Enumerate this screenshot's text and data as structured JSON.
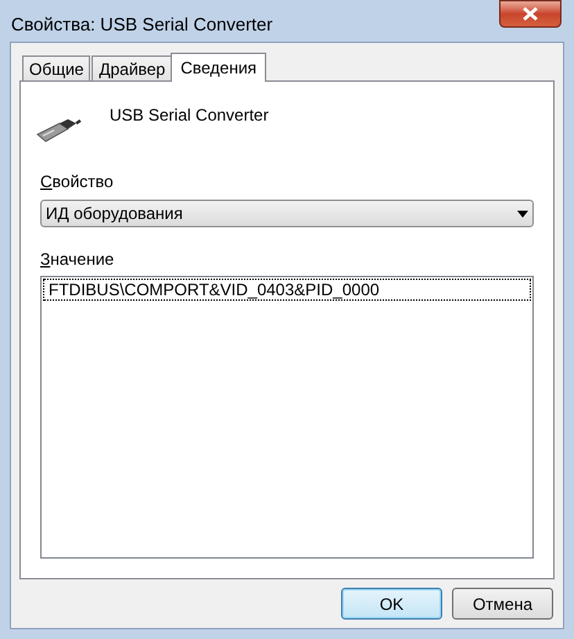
{
  "window": {
    "title": "Свойства: USB Serial Converter"
  },
  "tabs": [
    {
      "label": "Общие",
      "selected": false
    },
    {
      "label": "Драйвер",
      "selected": false
    },
    {
      "label": "Сведения",
      "selected": true
    }
  ],
  "device": {
    "name": "USB Serial Converter"
  },
  "property": {
    "label": "Свойство",
    "value": "ИД оборудования"
  },
  "values": {
    "label": "Значение",
    "items": [
      {
        "text": "FTDIBUS\\COMPORT&VID_0403&PID_0000",
        "selected": true
      }
    ]
  },
  "buttons": [
    {
      "label": "OK",
      "default": true
    },
    {
      "label": "Отмена",
      "default": false
    }
  ]
}
